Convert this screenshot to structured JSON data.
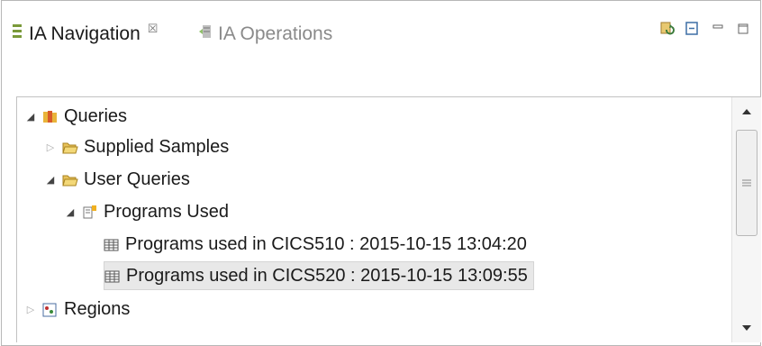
{
  "tabs": {
    "navigation": {
      "label": "IA Navigation",
      "close": "☒"
    },
    "operations": {
      "label": "IA Operations"
    }
  },
  "tree": {
    "queries": "Queries",
    "supplied_samples": "Supplied Samples",
    "user_queries": "User Queries",
    "programs_used": "Programs Used",
    "run1": "Programs used in CICS510 : 2015-10-15 13:04:20",
    "run2": "Programs used in CICS520 : 2015-10-15 13:09:55",
    "regions": "Regions"
  },
  "icons": {
    "nav_tab": "navigation-list-icon",
    "ops_tab": "operations-icon",
    "queries": "books-icon",
    "folder": "open-folder-icon",
    "query": "query-icon",
    "table": "table-icon",
    "regions": "regions-icon",
    "sync": "sync-icon",
    "collapse": "collapse-all-icon",
    "minimize": "minimize-icon",
    "maximize": "maximize-icon"
  }
}
